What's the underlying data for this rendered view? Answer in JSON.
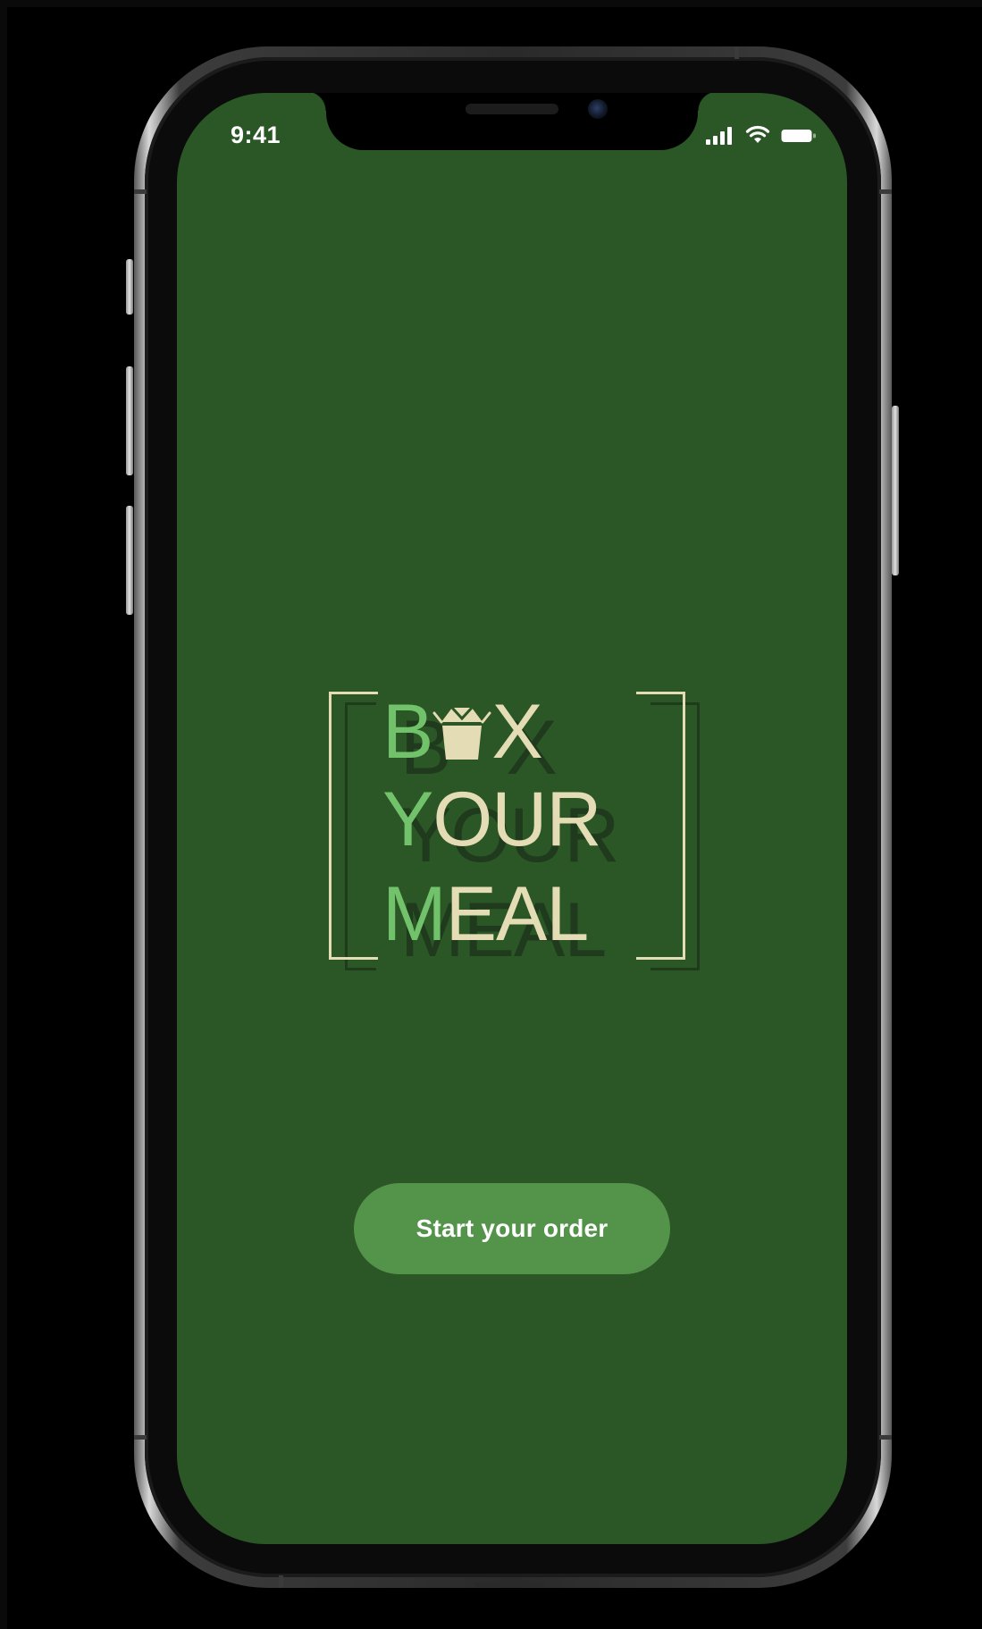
{
  "status_bar": {
    "time": "9:41",
    "signal_icon": "cellular-signal-icon",
    "wifi_icon": "wifi-icon",
    "battery_icon": "battery-icon"
  },
  "logo": {
    "line1_first": "B",
    "line1_rest": "X",
    "line1_icon": "takeout-box-icon",
    "line2_first": "Y",
    "line2_rest": "OUR",
    "line3_first": "M",
    "line3_rest": "EAL"
  },
  "cta": {
    "label": "Start your order"
  },
  "colors": {
    "screen_background": "#2b5626",
    "logo_cream": "#e4dcb4",
    "logo_green": "#71c26a",
    "button_green": "#53944a",
    "button_text": "#ffffff"
  }
}
